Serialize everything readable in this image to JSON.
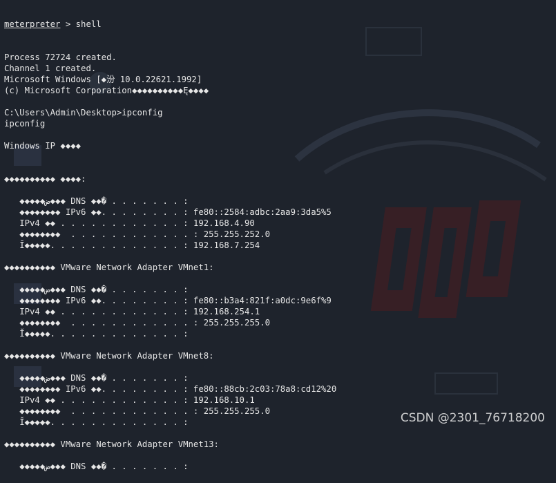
{
  "watermark": "CSDN @2301_76718200",
  "terminal": {
    "prompt": {
      "word": "meterpreter",
      "rest": " > shell"
    },
    "lines": [
      "Process 72724 created.",
      "Channel 1 created.",
      "Microsoft Windows [◆汾 10.0.22621.1992]",
      "(c) Microsoft Corporation◆◆◆◆◆◆◆◆◆◆Ę◆◆◆◆",
      "",
      "C:\\Users\\Admin\\Desktop>ipconfig",
      "ipconfig",
      "",
      "Windows IP ◆◆◆◆",
      "",
      "",
      "◆◆◆◆◆◆◆◆◆◆ ◆◆◆◆:",
      "",
      "   ◆◆◆◆◆ض◆◆◆ DNS ◆◆� . . . . . . . :",
      "   ◆◆◆◆◆◆◆◆ IPv6 ◆◆. . . . . . . . : fe80::2584:adbc:2aa9:3da5%5",
      "   IPv4 ◆◆ . . . . . . . . . . . . : 192.168.4.90",
      "   ◆◆◆◆◆◆◆◆  . . . . . . . . . . . . : 255.255.252.0",
      "   Ĭ◆◆◆◆◆. . . . . . . . . . . . . : 192.168.7.254",
      "",
      "◆◆◆◆◆◆◆◆◆◆ VMware Network Adapter VMnet1:",
      "",
      "   ◆◆◆◆◆ض◆◆◆ DNS ◆◆� . . . . . . . :",
      "   ◆◆◆◆◆◆◆◆ IPv6 ◆◆. . . . . . . . : fe80::b3a4:821f:a0dc:9e6f%9",
      "   IPv4 ◆◆ . . . . . . . . . . . . : 192.168.254.1",
      "   ◆◆◆◆◆◆◆◆  . . . . . . . . . . . . : 255.255.255.0",
      "   Ĭ◆◆◆◆◆. . . . . . . . . . . . . :",
      "",
      "◆◆◆◆◆◆◆◆◆◆ VMware Network Adapter VMnet8:",
      "",
      "   ◆◆◆◆◆ض◆◆◆ DNS ◆◆� . . . . . . . :",
      "   ◆◆◆◆◆◆◆◆ IPv6 ◆◆. . . . . . . . : fe80::88cb:2c03:78a8:cd12%20",
      "   IPv4 ◆◆ . . . . . . . . . . . . : 192.168.10.1",
      "   ◆◆◆◆◆◆◆◆  . . . . . . . . . . . . : 255.255.255.0",
      "   Ĭ◆◆◆◆◆. . . . . . . . . . . . . :",
      "",
      "◆◆◆◆◆◆◆◆◆◆ VMware Network Adapter VMnet13:",
      "",
      "   ◆◆◆◆◆ض◆◆◆ DNS ◆◆� . . . . . . . :"
    ]
  }
}
